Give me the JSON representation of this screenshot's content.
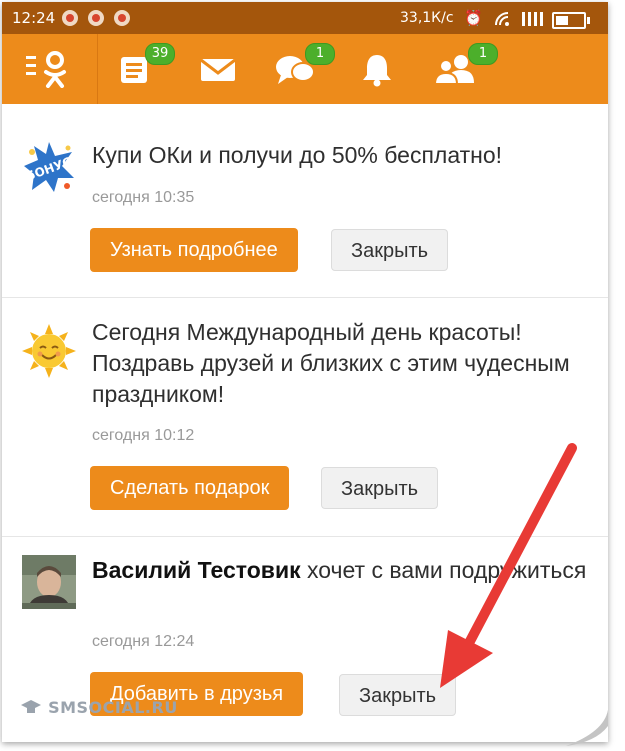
{
  "status_bar": {
    "time": "12:24",
    "network_speed": "33,1К/с",
    "icons": [
      "notification-icon",
      "recording-icon",
      "notification-icon",
      "alarm-icon",
      "wifi-icon",
      "signal-icon",
      "battery-icon"
    ]
  },
  "nav": {
    "menu_icon": "ok-logo-menu-icon",
    "items": [
      {
        "icon": "feed-icon",
        "badge": "39"
      },
      {
        "icon": "messages-icon",
        "badge": ""
      },
      {
        "icon": "discussions-icon",
        "badge": "1"
      },
      {
        "icon": "notifications-bell-icon",
        "badge": ""
      },
      {
        "icon": "friends-icon",
        "badge": "1"
      }
    ]
  },
  "notifications": [
    {
      "icon": "bonus-icon",
      "text": "Купи ОКи и получи до 50% бесплатно!",
      "time": "сегодня 10:35",
      "primary_action": "Узнать подробнее",
      "secondary_action": "Закрыть"
    },
    {
      "icon": "sun-icon",
      "text": "Сегодня Международный день красоты! Поздравь друзей и близких с этим чудесным праздником!",
      "time": "сегодня 10:12",
      "primary_action": "Сделать подарок",
      "secondary_action": "Закрыть"
    },
    {
      "icon": "avatar",
      "name": "Василий Тестовик",
      "text": " хочет с вами подружиться",
      "time": "сегодня 12:24",
      "primary_action": "Добавить в друзья",
      "secondary_action": "Закрыть"
    }
  ],
  "watermark": "SMSOCIAL.RU",
  "colors": {
    "brand_orange": "#ed8b1b",
    "status_bar": "#a4560c",
    "badge_green": "#4caf2b",
    "arrow_red": "#e83a35"
  }
}
